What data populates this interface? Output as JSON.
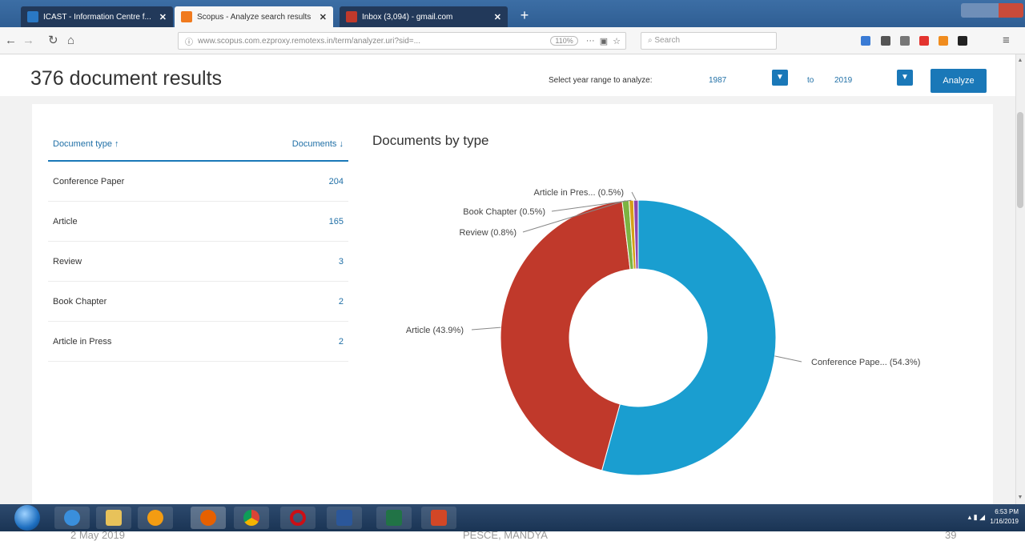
{
  "browser": {
    "tabs": [
      {
        "title": "ICAST - Information Centre f...",
        "color": "#2a78c4"
      },
      {
        "title": "Scopus - Analyze search results",
        "color": "#f07a1e"
      },
      {
        "title": "Inbox (3,094) - gmail.com",
        "color": "#c0392b"
      }
    ],
    "url": "www.scopus.com.ezproxy.remotexs.in/term/analyzer.uri?sid=...",
    "zoom": "110%",
    "more": "···",
    "search_placeholder": "Search"
  },
  "page": {
    "title": "376 document results",
    "year_range_label": "Select year range to analyze:",
    "year_from": "1987",
    "year_to_label": "to",
    "year_to": "2019",
    "analyze_label": "Analyze"
  },
  "table": {
    "col_type": "Document type ↑",
    "col_docs": "Documents ↓",
    "rows": [
      {
        "type": "Conference Paper",
        "count": "204"
      },
      {
        "type": "Article",
        "count": "165"
      },
      {
        "type": "Review",
        "count": "3"
      },
      {
        "type": "Book Chapter",
        "count": "2"
      },
      {
        "type": "Article in Press",
        "count": "2"
      }
    ]
  },
  "chart_title": "Documents by type",
  "chart_data": {
    "type": "pie",
    "title": "Documents by type",
    "categories": [
      "Conference Paper",
      "Article",
      "Review",
      "Book Chapter",
      "Article in Press"
    ],
    "values": [
      204,
      165,
      3,
      2,
      2
    ],
    "labels": [
      "Conference Pape... (54.3%)",
      "Article (43.9%)",
      "Review (0.8%)",
      "Book Chapter (0.5%)",
      "Article in Pres... (0.5%)"
    ],
    "colors": [
      "#1a9ed0",
      "#c0392b",
      "#7cb342",
      "#d4a017",
      "#8e44ad"
    ],
    "donut": true
  },
  "taskbar": {
    "clock_time": "6:53 PM",
    "clock_date": "1/16/2019"
  },
  "footer": {
    "date": "2 May 2019",
    "center": "PESCE, MANDYA",
    "page": "39"
  }
}
